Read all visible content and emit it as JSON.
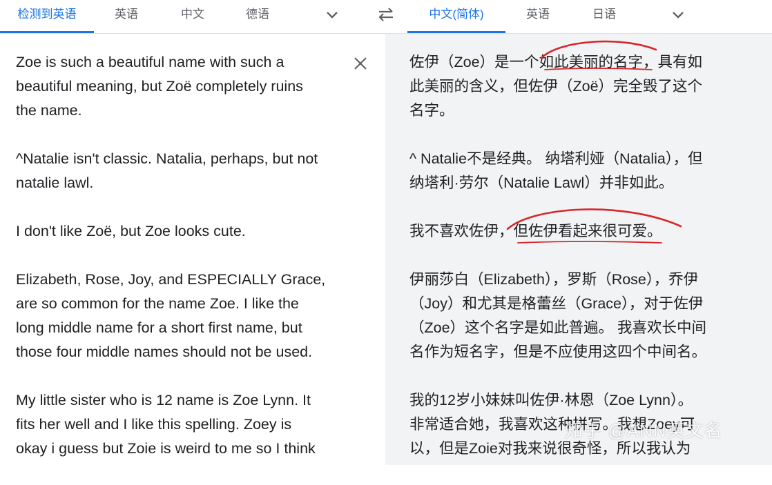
{
  "source_tabs": [
    {
      "label": "检测到英语",
      "active": true
    },
    {
      "label": "英语",
      "active": false
    },
    {
      "label": "中文",
      "active": false
    },
    {
      "label": "德语",
      "active": false
    }
  ],
  "target_tabs": [
    {
      "label": "中文(简体)",
      "active": true
    },
    {
      "label": "英语",
      "active": false
    },
    {
      "label": "日语",
      "active": false
    }
  ],
  "icons": {
    "source_more": "chevron-down-icon",
    "swap": "swap-languages-icon",
    "target_more": "chevron-down-icon",
    "clear": "close-icon"
  },
  "source": {
    "paragraphs": [
      "Zoe is such a beautiful name with such a\nbeautiful meaning, but Zoë completely ruins\nthe name.",
      "^Natalie isn't classic. Natalia, perhaps, but not\nnatalie lawl.",
      "I don't like Zoë, but Zoe looks cute.",
      "Elizabeth, Rose, Joy, and ESPECIALLY Grace,\nare so common for the name Zoe. I like the\nlong middle name for a short first name, but\nthose four middle names should not be used.",
      "My little sister who is 12 name is Zoe Lynn. It\nfits her well and I like this spelling. Zoey is\nokay i guess but Zoie is weird to me so I think"
    ]
  },
  "translation": {
    "paragraphs": [
      "佐伊（Zoe）是一个如此美丽的名字，具有如\n此美丽的含义，但佐伊（Zoë）完全毁了这个\n名字。",
      "^ Natalie不是经典。 纳塔利娅（Natalia），但\n纳塔利·劳尔（Natalie Lawl）并非如此。",
      "我不喜欢佐伊，但佐伊看起来很可爱。",
      "伊丽莎白（Elizabeth），罗斯（Rose），乔伊\n（Joy）和尤其是格蕾丝（Grace），对于佐伊\n（Zoe）这个名字是如此普遍。 我喜欢长中间\n名作为短名字，但是不应使用这四个中间名。",
      "我的12岁小妹妹叫佐伊·林恩（Zoe Lynn）。\n非常适合她，我喜欢这种拼写。我想Zoey可\n以，但是Zoie对我来说很奇怪，所以我认为"
    ]
  },
  "watermark": "知乎 @ANN英文名",
  "colors": {
    "accent": "#1a73e8",
    "annotation": "#d7262b",
    "translation_bg": "#f1f3f4"
  }
}
